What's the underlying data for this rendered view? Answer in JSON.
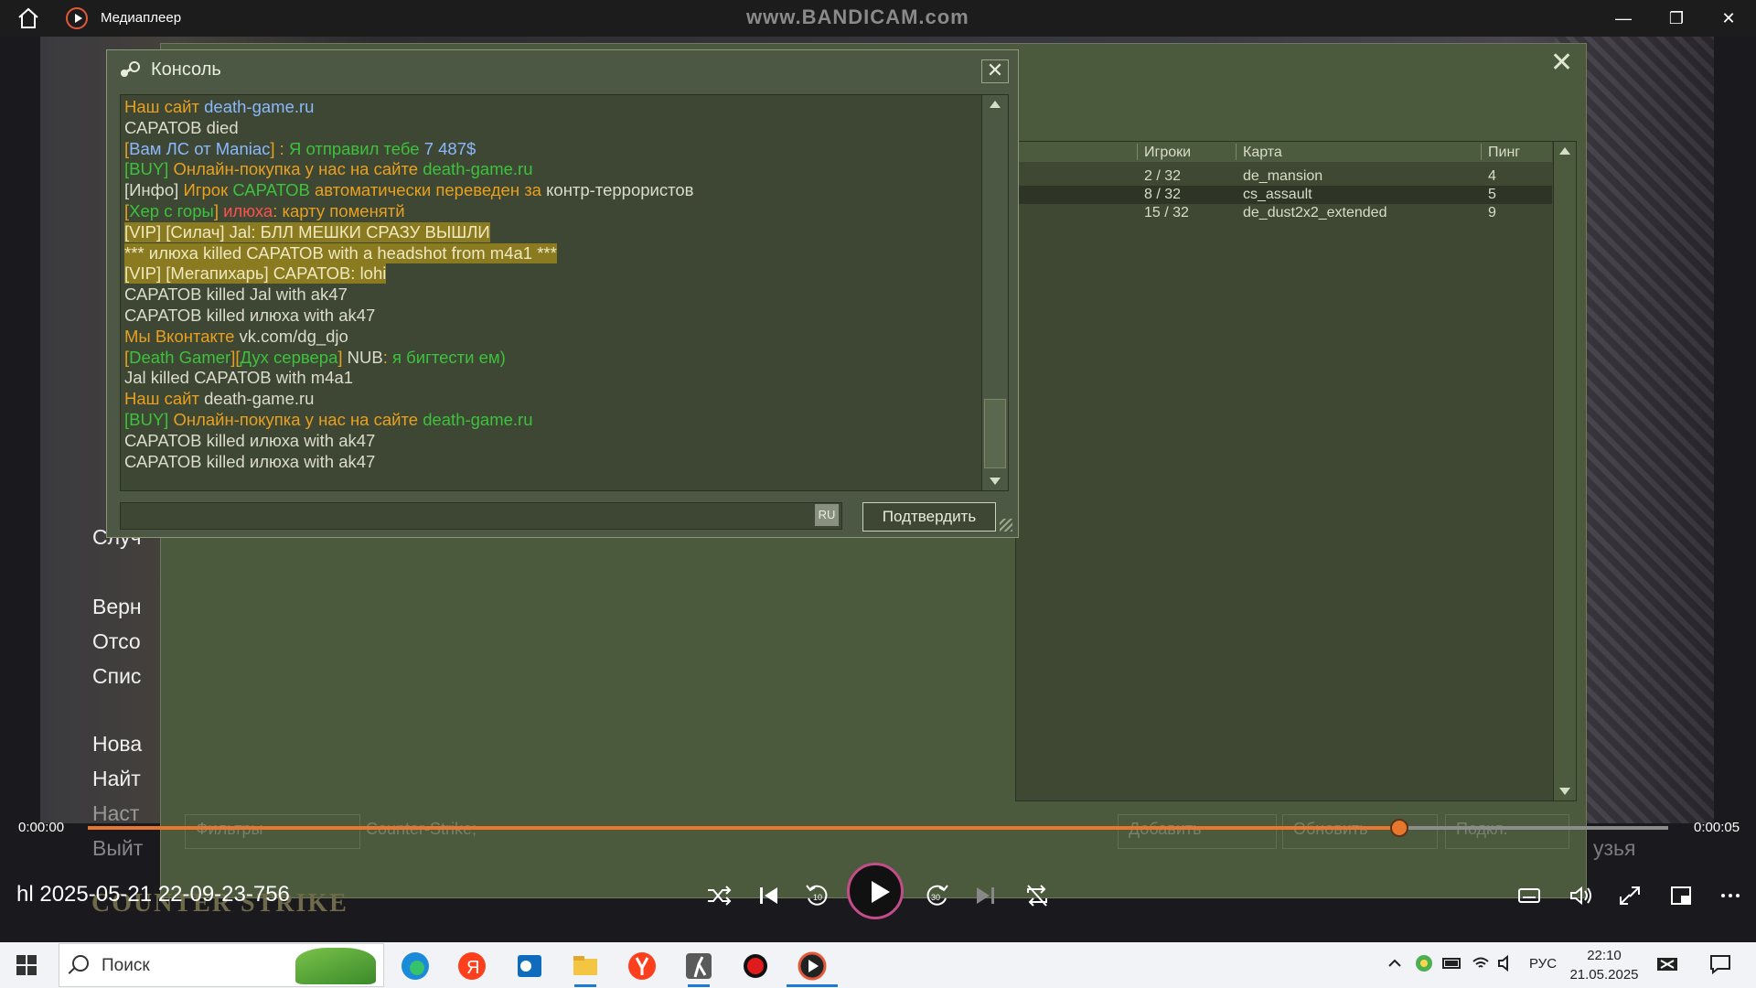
{
  "window": {
    "title": "Медиаплеер",
    "watermark": "www.BANDICAM.com",
    "minimize": "—",
    "maximize": "❐",
    "close": "✕"
  },
  "server_list": {
    "headers": [
      "Игроки",
      "Карта",
      "Пинг"
    ],
    "rows": [
      {
        "players": "2 / 32",
        "map": "de_mansion",
        "ping": "4",
        "selected": false
      },
      {
        "players": "8 / 32",
        "map": "cs_assault",
        "ping": "5",
        "selected": true
      },
      {
        "players": "15 / 32",
        "map": "de_dust2x2_extended",
        "ping": "9",
        "selected": false
      }
    ],
    "faded_buttons": [
      "Фильтры",
      "Counter-Strike;",
      "Добавить",
      "Обновить",
      "Подкл."
    ],
    "close": "✕"
  },
  "cs_menu": {
    "items": [
      "Случ",
      "Верн",
      "Отсо",
      "Спис",
      "Нова",
      "Найт",
      "Наст",
      "Выйт"
    ],
    "faded_right": "узья",
    "logo": "COUNTER STRIKE"
  },
  "console": {
    "title": "Консоль",
    "close": "✕",
    "input_value": "",
    "lang": "RU",
    "submit": "Подтвердить",
    "lines": [
      {
        "hl": false,
        "parts": [
          {
            "t": "Наш сайт ",
            "c": "c-o"
          },
          {
            "t": "death-game.ru",
            "c": "c-b"
          }
        ]
      },
      {
        "hl": false,
        "parts": [
          {
            "t": "САРАТОВ died",
            "c": "c-w"
          }
        ]
      },
      {
        "hl": false,
        "parts": [
          {
            "t": "[",
            "c": "c-o"
          },
          {
            "t": "Вам ЛС от ",
            "c": "c-b"
          },
          {
            "t": "Maniac",
            "c": "c-b"
          },
          {
            "t": "] : ",
            "c": "c-o"
          },
          {
            "t": "Я отправил тебе ",
            "c": "c-g"
          },
          {
            "t": "7 487$",
            "c": "c-b"
          }
        ]
      },
      {
        "hl": false,
        "parts": [
          {
            "t": "[BUY] ",
            "c": "c-g"
          },
          {
            "t": "Онлайн-покупка у нас на сайте ",
            "c": "c-o"
          },
          {
            "t": "death-game.ru",
            "c": "c-g"
          }
        ]
      },
      {
        "hl": false,
        "parts": [
          {
            "t": "[Инфо] ",
            "c": "c-w"
          },
          {
            "t": "Игрок ",
            "c": "c-o"
          },
          {
            "t": "САРАТОВ ",
            "c": "c-g"
          },
          {
            "t": "автоматически переведен за ",
            "c": "c-o"
          },
          {
            "t": "контр-террористов",
            "c": "c-w"
          }
        ]
      },
      {
        "hl": false,
        "parts": [
          {
            "t": "[",
            "c": "c-o"
          },
          {
            "t": "Хер с горы",
            "c": "c-g"
          },
          {
            "t": "] ",
            "c": "c-o"
          },
          {
            "t": "илюха",
            "c": "c-r"
          },
          {
            "t": ": карту поменятй",
            "c": "c-o"
          }
        ]
      },
      {
        "hl": true,
        "parts": [
          {
            "t": "[VIP] [Силач] Jal: БЛЛ МЕШКИ СРАЗУ ВЫШЛИ",
            "c": "c-y"
          }
        ]
      },
      {
        "hl": true,
        "parts": [
          {
            "t": "*** илюха killed САРАТОВ with a headshot from m4a1 ***",
            "c": "c-y"
          }
        ]
      },
      {
        "hl": true,
        "parts": [
          {
            "t": "[VIP] [Мегапихарь] САРАТОВ: lohi",
            "c": "c-y"
          }
        ]
      },
      {
        "hl": false,
        "parts": [
          {
            "t": "САРАТОВ killed Jal with ak47",
            "c": "c-w"
          }
        ]
      },
      {
        "hl": false,
        "parts": [
          {
            "t": "САРАТОВ killed илюха with ak47",
            "c": "c-w"
          }
        ]
      },
      {
        "hl": false,
        "parts": [
          {
            "t": "Мы Вконтакте ",
            "c": "c-o"
          },
          {
            "t": "vk.com/dg_djo",
            "c": "c-w"
          }
        ]
      },
      {
        "hl": false,
        "parts": [
          {
            "t": "[",
            "c": "c-o"
          },
          {
            "t": "Death Gamer",
            "c": "c-g"
          },
          {
            "t": "][",
            "c": "c-o"
          },
          {
            "t": "Дух сервера",
            "c": "c-g"
          },
          {
            "t": "] ",
            "c": "c-o"
          },
          {
            "t": "NUB",
            "c": "c-w"
          },
          {
            "t": ": ",
            "c": "c-o"
          },
          {
            "t": "я бигтести ем)",
            "c": "c-g"
          }
        ]
      },
      {
        "hl": false,
        "parts": [
          {
            "t": "Jal killed САРАТОВ with m4a1",
            "c": "c-w"
          }
        ]
      },
      {
        "hl": false,
        "parts": [
          {
            "t": "Наш сайт ",
            "c": "c-o"
          },
          {
            "t": "death-game.ru",
            "c": "c-w"
          }
        ]
      },
      {
        "hl": false,
        "parts": [
          {
            "t": "[BUY] ",
            "c": "c-g"
          },
          {
            "t": "Онлайн-покупка у нас на сайте ",
            "c": "c-o"
          },
          {
            "t": "death-game.ru",
            "c": "c-g"
          }
        ]
      },
      {
        "hl": false,
        "parts": [
          {
            "t": "САРАТОВ killed илюха with ak47",
            "c": "c-w"
          }
        ]
      },
      {
        "hl": false,
        "parts": [
          {
            "t": "САРАТОВ killed илюха with ak47",
            "c": "c-w"
          }
        ]
      }
    ]
  },
  "player": {
    "time_current": "0:00:00",
    "time_total": "0:00:05",
    "progress": 0.83,
    "file_name": "hl 2025-05-21 22-09-23-756",
    "accent": "#e8772e"
  },
  "taskbar": {
    "search_placeholder": "Поиск",
    "lang": "РУС",
    "time": "22:10",
    "date": "21.05.2025"
  }
}
